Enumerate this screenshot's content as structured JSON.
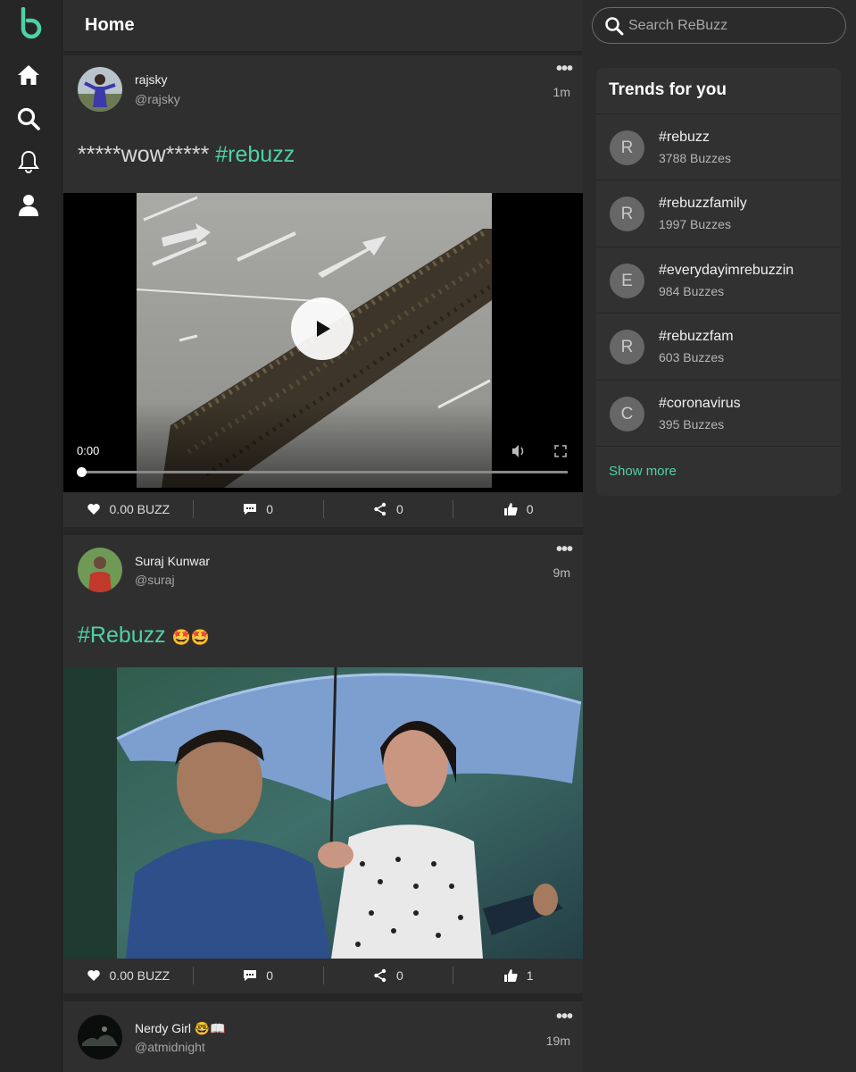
{
  "header": {
    "title": "Home"
  },
  "search": {
    "placeholder": "Search ReBuzz"
  },
  "nav": {
    "items": [
      "home-icon",
      "search-icon",
      "bell-icon",
      "user-icon"
    ]
  },
  "colors": {
    "accent": "#4fd1a5",
    "background": "#2b2b2b",
    "card": "#2f2f2f"
  },
  "posts": [
    {
      "name": "rajsky",
      "handle": "@rajsky",
      "time": "1m",
      "text_plain": "*****wow***** ",
      "hashtag": "#rebuzz",
      "media_type": "video",
      "video_time": "0:00",
      "buzz": "0.00 BUZZ",
      "comments": "0",
      "shares": "0",
      "likes": "0"
    },
    {
      "name": "Suraj Kunwar",
      "handle": "@suraj",
      "time": "9m",
      "hashtag": "#Rebuzz",
      "emoji": "🤩🤩",
      "media_type": "image",
      "buzz": "0.00 BUZZ",
      "comments": "0",
      "shares": "0",
      "likes": "1"
    },
    {
      "name": "Nerdy Girl 🤓📖",
      "handle": "@atmidnight",
      "time": "19m"
    }
  ],
  "trends": {
    "title": "Trends for you",
    "items": [
      {
        "letter": "R",
        "tag": "#rebuzz",
        "count": "3788 Buzzes"
      },
      {
        "letter": "R",
        "tag": "#rebuzzfamily",
        "count": "1997 Buzzes"
      },
      {
        "letter": "E",
        "tag": "#everydayimrebuzzin",
        "count": "984 Buzzes"
      },
      {
        "letter": "R",
        "tag": "#rebuzzfam",
        "count": "603 Buzzes"
      },
      {
        "letter": "C",
        "tag": "#coronavirus",
        "count": "395 Buzzes"
      }
    ],
    "show_more": "Show more"
  }
}
